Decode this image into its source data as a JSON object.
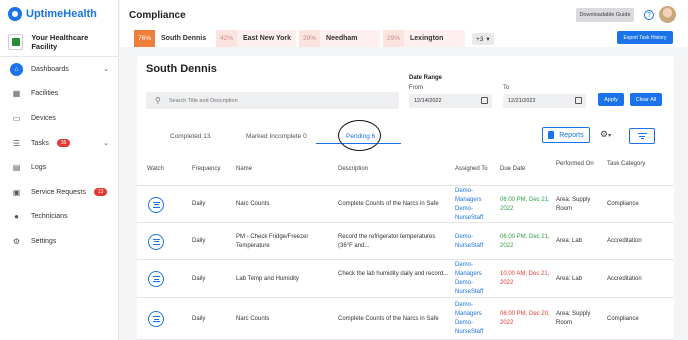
{
  "app": {
    "name": "UptimeHealth",
    "facility": "Your Healthcare Facility"
  },
  "sidebar": {
    "items": [
      {
        "label": "Dashboards",
        "icon": "home-icon",
        "active": true,
        "chevron": true
      },
      {
        "label": "Facilities",
        "icon": "building-icon"
      },
      {
        "label": "Devices",
        "icon": "devices-icon"
      },
      {
        "label": "Tasks",
        "icon": "tasks-icon",
        "badge": "36",
        "chevron": true
      },
      {
        "label": "Logs",
        "icon": "logs-icon"
      },
      {
        "label": "Service Requests",
        "icon": "clipboard-icon",
        "badge": "13"
      },
      {
        "label": "Technicians",
        "icon": "people-icon"
      },
      {
        "label": "Settings",
        "icon": "gear-icon"
      }
    ]
  },
  "header": {
    "title": "Compliance",
    "download_label": "Downloadable Guide"
  },
  "locations": [
    {
      "pct": "76%",
      "name": "South Dennis"
    },
    {
      "pct": "42%",
      "name": "East New York"
    },
    {
      "pct": "29%",
      "name": "Needham"
    },
    {
      "pct": "29%",
      "name": "Lexington"
    }
  ],
  "more_locations": "+3",
  "export_label": "Export Task History",
  "location_title": "South Dennis",
  "search": {
    "placeholder": "Search Title and Description"
  },
  "date_range": {
    "label": "Date Range",
    "from_label": "From",
    "to_label": "To",
    "from": "12/14/2022",
    "to": "12/21/2022"
  },
  "buttons": {
    "apply": "Apply",
    "clear": "Clear All",
    "reports": "Reports"
  },
  "tabs": [
    "Completed 13",
    "Marked Incomplete 0",
    "Pending 6"
  ],
  "columns": [
    "Watch",
    "Frequency",
    "Name",
    "Description",
    "Assigned To",
    "Due Date",
    "Performed On",
    "Task Category"
  ],
  "rows": [
    {
      "frequency": "Daily",
      "name": "Narc Counts",
      "description": "Complete Counts of the Narcs in Safe",
      "assigned": [
        "Demo-",
        "Managers",
        "Demo-",
        "NurseStaff"
      ],
      "due": [
        "06:00 PM, Dec 21,",
        "2022"
      ],
      "due_status": "green",
      "performed_on": [
        "Area: Supply",
        "Room"
      ],
      "category": "Compliance"
    },
    {
      "frequency": "Daily",
      "name": "PM - Check Fridge/Freezer Temperature",
      "description": "Record the refrigerator temperatures (36°F and...",
      "assigned": [
        "Demo-",
        "NurseStaff"
      ],
      "due": [
        "06:00 PM, Dec 21,",
        "2022"
      ],
      "due_status": "green",
      "performed_on": [
        "Area: Lab"
      ],
      "category": "Accreditation"
    },
    {
      "frequency": "Daily",
      "name": "Lab Temp and Humidity",
      "description": "Check the lab humidity daily and record...",
      "assigned": [
        "Demo-",
        "Managers",
        "Demo-",
        "NurseStaff"
      ],
      "due": [
        "10:00 AM, Dec 21,",
        "2022"
      ],
      "due_status": "red",
      "performed_on": [
        "Area: Lab"
      ],
      "category": "Accreditation"
    },
    {
      "frequency": "Daily",
      "name": "Narc Counts",
      "description": "Complete Counts of the Narcs in Safe",
      "assigned": [
        "Demo-",
        "Managers",
        "Demo-",
        "NurseStaff"
      ],
      "due": [
        "06:00 PM, Dec 20,",
        "2022"
      ],
      "due_status": "red",
      "performed_on": [
        "Area: Supply",
        "Room"
      ],
      "category": "Compliance"
    }
  ],
  "colors": {
    "accent": "#1a73e8",
    "top_pct_bg": "#f07f3c",
    "other_pct_bg": "#fbe3e0",
    "other_loc_bg": "#fdf0ee",
    "due_green": "#2e9e44",
    "due_red": "#e53935"
  }
}
